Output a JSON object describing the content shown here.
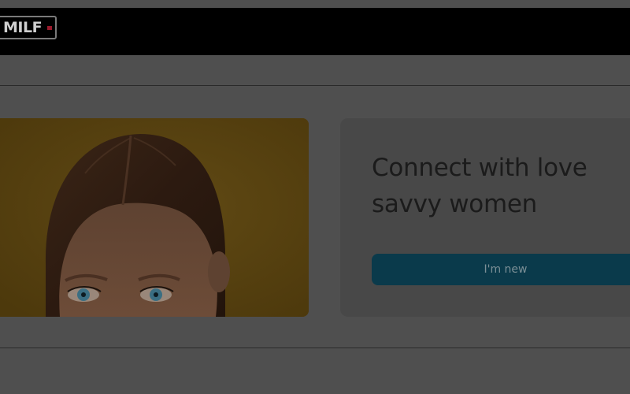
{
  "header": {
    "logo_text": "MILF",
    "logo_icon": "brand-dot-icon"
  },
  "hero": {
    "image_icon": "woman-portrait-photo"
  },
  "signup_card": {
    "headline": "Connect with love savvy women",
    "new_button_label": "I'm new"
  },
  "colors": {
    "header_bg": "#000000",
    "page_bg": "#4f4f4f",
    "button_bg": "#0a3a4b",
    "logo_accent": "#9a1a2c",
    "photo_bg": "#5b4410"
  }
}
